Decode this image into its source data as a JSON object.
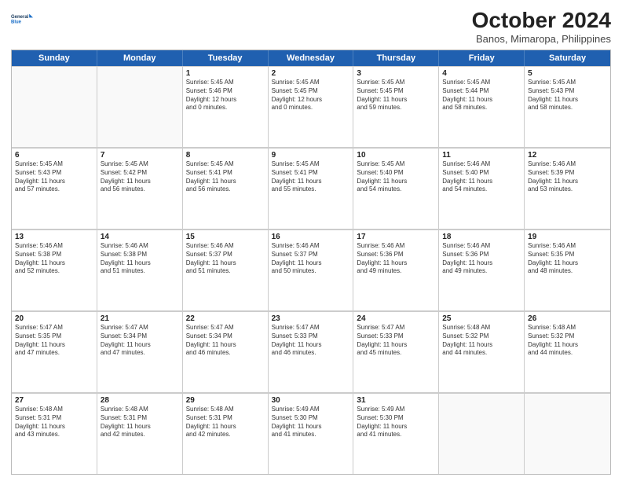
{
  "header": {
    "logo_line1": "General",
    "logo_line2": "Blue",
    "month": "October 2024",
    "location": "Banos, Mimaropa, Philippines"
  },
  "weekdays": [
    "Sunday",
    "Monday",
    "Tuesday",
    "Wednesday",
    "Thursday",
    "Friday",
    "Saturday"
  ],
  "rows": [
    [
      {
        "day": "",
        "info": ""
      },
      {
        "day": "",
        "info": ""
      },
      {
        "day": "1",
        "info": "Sunrise: 5:45 AM\nSunset: 5:46 PM\nDaylight: 12 hours\nand 0 minutes."
      },
      {
        "day": "2",
        "info": "Sunrise: 5:45 AM\nSunset: 5:45 PM\nDaylight: 12 hours\nand 0 minutes."
      },
      {
        "day": "3",
        "info": "Sunrise: 5:45 AM\nSunset: 5:45 PM\nDaylight: 11 hours\nand 59 minutes."
      },
      {
        "day": "4",
        "info": "Sunrise: 5:45 AM\nSunset: 5:44 PM\nDaylight: 11 hours\nand 58 minutes."
      },
      {
        "day": "5",
        "info": "Sunrise: 5:45 AM\nSunset: 5:43 PM\nDaylight: 11 hours\nand 58 minutes."
      }
    ],
    [
      {
        "day": "6",
        "info": "Sunrise: 5:45 AM\nSunset: 5:43 PM\nDaylight: 11 hours\nand 57 minutes."
      },
      {
        "day": "7",
        "info": "Sunrise: 5:45 AM\nSunset: 5:42 PM\nDaylight: 11 hours\nand 56 minutes."
      },
      {
        "day": "8",
        "info": "Sunrise: 5:45 AM\nSunset: 5:41 PM\nDaylight: 11 hours\nand 56 minutes."
      },
      {
        "day": "9",
        "info": "Sunrise: 5:45 AM\nSunset: 5:41 PM\nDaylight: 11 hours\nand 55 minutes."
      },
      {
        "day": "10",
        "info": "Sunrise: 5:45 AM\nSunset: 5:40 PM\nDaylight: 11 hours\nand 54 minutes."
      },
      {
        "day": "11",
        "info": "Sunrise: 5:46 AM\nSunset: 5:40 PM\nDaylight: 11 hours\nand 54 minutes."
      },
      {
        "day": "12",
        "info": "Sunrise: 5:46 AM\nSunset: 5:39 PM\nDaylight: 11 hours\nand 53 minutes."
      }
    ],
    [
      {
        "day": "13",
        "info": "Sunrise: 5:46 AM\nSunset: 5:38 PM\nDaylight: 11 hours\nand 52 minutes."
      },
      {
        "day": "14",
        "info": "Sunrise: 5:46 AM\nSunset: 5:38 PM\nDaylight: 11 hours\nand 51 minutes."
      },
      {
        "day": "15",
        "info": "Sunrise: 5:46 AM\nSunset: 5:37 PM\nDaylight: 11 hours\nand 51 minutes."
      },
      {
        "day": "16",
        "info": "Sunrise: 5:46 AM\nSunset: 5:37 PM\nDaylight: 11 hours\nand 50 minutes."
      },
      {
        "day": "17",
        "info": "Sunrise: 5:46 AM\nSunset: 5:36 PM\nDaylight: 11 hours\nand 49 minutes."
      },
      {
        "day": "18",
        "info": "Sunrise: 5:46 AM\nSunset: 5:36 PM\nDaylight: 11 hours\nand 49 minutes."
      },
      {
        "day": "19",
        "info": "Sunrise: 5:46 AM\nSunset: 5:35 PM\nDaylight: 11 hours\nand 48 minutes."
      }
    ],
    [
      {
        "day": "20",
        "info": "Sunrise: 5:47 AM\nSunset: 5:35 PM\nDaylight: 11 hours\nand 47 minutes."
      },
      {
        "day": "21",
        "info": "Sunrise: 5:47 AM\nSunset: 5:34 PM\nDaylight: 11 hours\nand 47 minutes."
      },
      {
        "day": "22",
        "info": "Sunrise: 5:47 AM\nSunset: 5:34 PM\nDaylight: 11 hours\nand 46 minutes."
      },
      {
        "day": "23",
        "info": "Sunrise: 5:47 AM\nSunset: 5:33 PM\nDaylight: 11 hours\nand 46 minutes."
      },
      {
        "day": "24",
        "info": "Sunrise: 5:47 AM\nSunset: 5:33 PM\nDaylight: 11 hours\nand 45 minutes."
      },
      {
        "day": "25",
        "info": "Sunrise: 5:48 AM\nSunset: 5:32 PM\nDaylight: 11 hours\nand 44 minutes."
      },
      {
        "day": "26",
        "info": "Sunrise: 5:48 AM\nSunset: 5:32 PM\nDaylight: 11 hours\nand 44 minutes."
      }
    ],
    [
      {
        "day": "27",
        "info": "Sunrise: 5:48 AM\nSunset: 5:31 PM\nDaylight: 11 hours\nand 43 minutes."
      },
      {
        "day": "28",
        "info": "Sunrise: 5:48 AM\nSunset: 5:31 PM\nDaylight: 11 hours\nand 42 minutes."
      },
      {
        "day": "29",
        "info": "Sunrise: 5:48 AM\nSunset: 5:31 PM\nDaylight: 11 hours\nand 42 minutes."
      },
      {
        "day": "30",
        "info": "Sunrise: 5:49 AM\nSunset: 5:30 PM\nDaylight: 11 hours\nand 41 minutes."
      },
      {
        "day": "31",
        "info": "Sunrise: 5:49 AM\nSunset: 5:30 PM\nDaylight: 11 hours\nand 41 minutes."
      },
      {
        "day": "",
        "info": ""
      },
      {
        "day": "",
        "info": ""
      }
    ]
  ]
}
